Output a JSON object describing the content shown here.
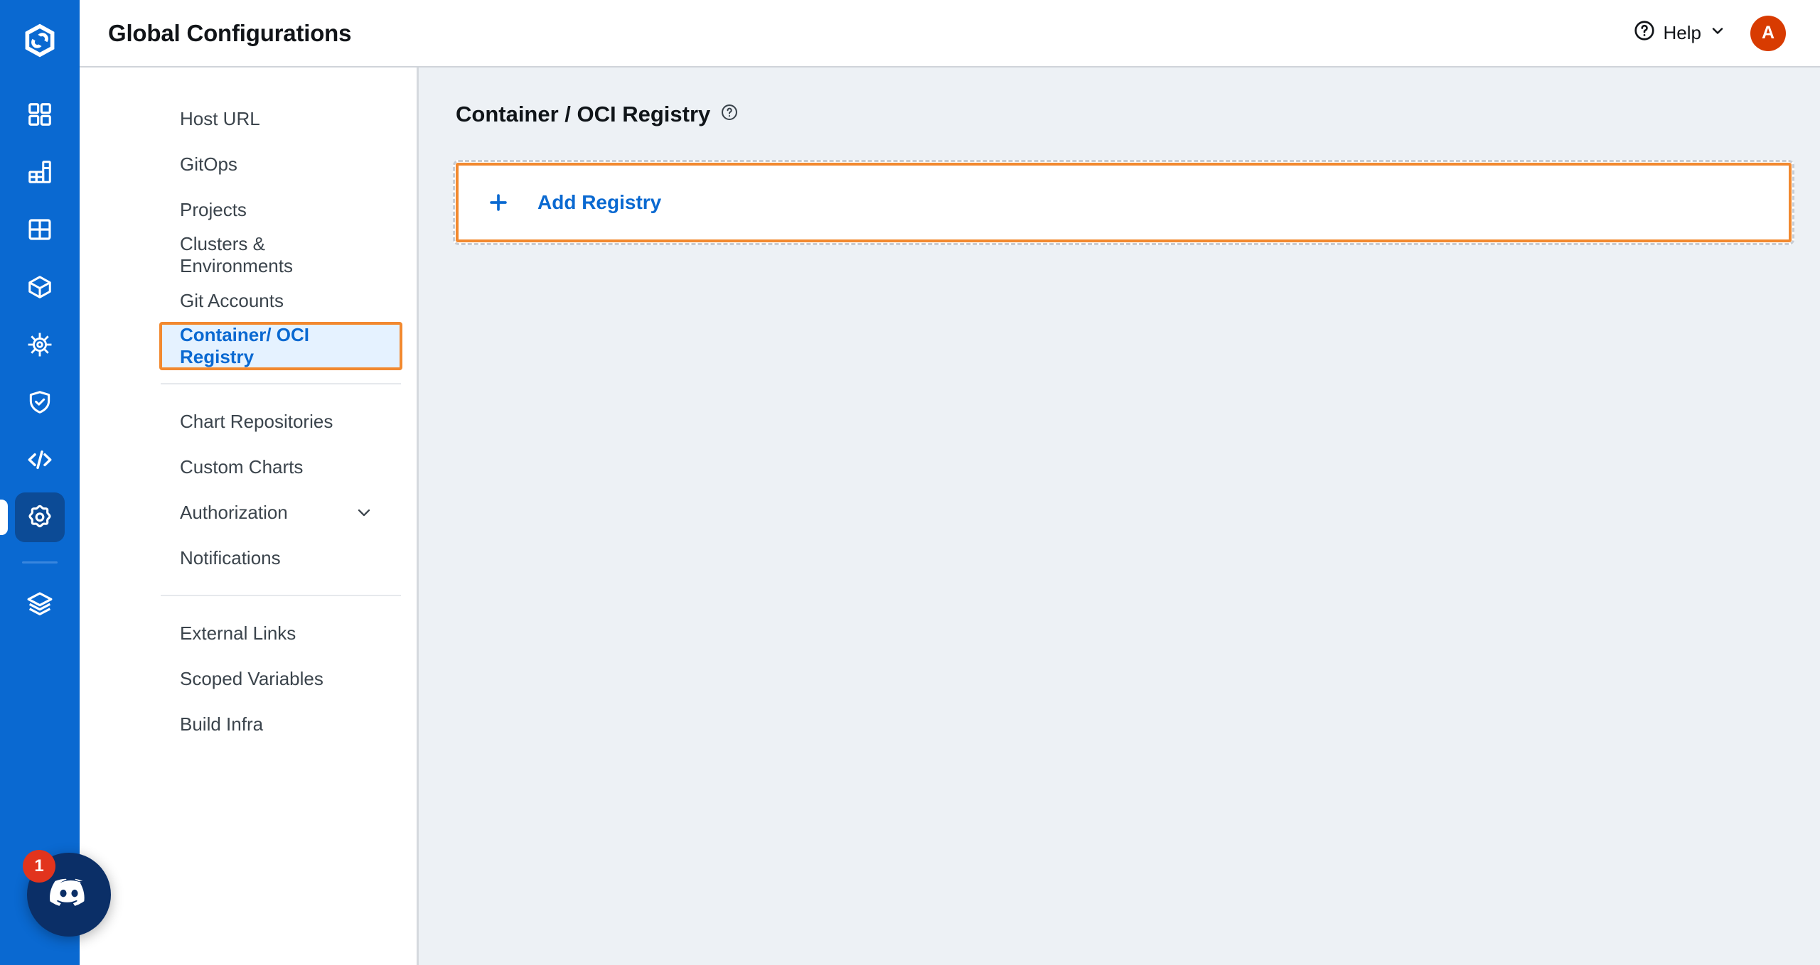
{
  "brand": {
    "logo_icon": "devtron-logo-icon",
    "rail_bg": "#0a69d1",
    "active_bg": "#0c4b96"
  },
  "rail": {
    "items": [
      {
        "icon": "apps-grid-icon",
        "name": "applications"
      },
      {
        "icon": "jobs-chart-icon",
        "name": "jobs"
      },
      {
        "icon": "app-groups-icon",
        "name": "application-groups"
      },
      {
        "icon": "cube-icon",
        "name": "resource-browser"
      },
      {
        "icon": "helm-wheel-icon",
        "name": "chart-store"
      },
      {
        "icon": "shield-check-icon",
        "name": "security"
      },
      {
        "icon": "code-brackets-icon",
        "name": "bulk-edit"
      },
      {
        "icon": "gear-icon",
        "name": "global-configurations",
        "active": true
      },
      {
        "icon": "stack-layers-icon",
        "name": "stack-manager"
      }
    ]
  },
  "discord": {
    "icon": "discord-icon",
    "badge": "1"
  },
  "header": {
    "title": "Global Configurations",
    "help_icon": "question-circle-icon",
    "help_label": "Help",
    "help_chevron_icon": "chevron-down-icon",
    "avatar_initial": "A",
    "avatar_color": "#d83b01"
  },
  "sidebar": {
    "groups": [
      {
        "items": [
          {
            "label": "Host URL",
            "name": "host-url",
            "selected": false,
            "expandable": false
          },
          {
            "label": "GitOps",
            "name": "gitops",
            "selected": false,
            "expandable": false
          },
          {
            "label": "Projects",
            "name": "projects",
            "selected": false,
            "expandable": false
          },
          {
            "label": "Clusters & Environments",
            "name": "clusters-environments",
            "selected": false,
            "expandable": false
          },
          {
            "label": "Git Accounts",
            "name": "git-accounts",
            "selected": false,
            "expandable": false
          },
          {
            "label": "Container/ OCI Registry",
            "name": "container-oci-registry",
            "selected": true,
            "expandable": false
          }
        ]
      },
      {
        "items": [
          {
            "label": "Chart Repositories",
            "name": "chart-repositories",
            "selected": false,
            "expandable": false
          },
          {
            "label": "Custom Charts",
            "name": "custom-charts",
            "selected": false,
            "expandable": false
          },
          {
            "label": "Authorization",
            "name": "authorization",
            "selected": false,
            "expandable": true
          },
          {
            "label": "Notifications",
            "name": "notifications",
            "selected": false,
            "expandable": false
          }
        ]
      },
      {
        "items": [
          {
            "label": "External Links",
            "name": "external-links",
            "selected": false,
            "expandable": false
          },
          {
            "label": "Scoped Variables",
            "name": "scoped-variables",
            "selected": false,
            "expandable": false
          },
          {
            "label": "Build Infra",
            "name": "build-infra",
            "selected": false,
            "expandable": false
          }
        ]
      }
    ]
  },
  "main": {
    "title": "Container / OCI Registry",
    "title_info_icon": "question-circle-icon",
    "add_registry": {
      "plus_icon": "plus-icon",
      "label": "Add Registry",
      "highlight_color": "#f2892f",
      "link_color": "#0a69d1"
    }
  }
}
